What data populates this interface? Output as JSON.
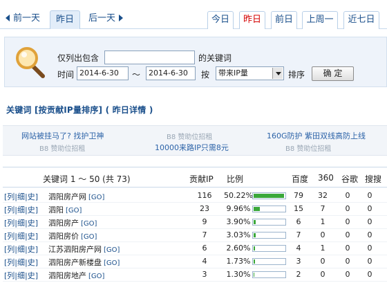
{
  "day_nav": {
    "prev_label": "前一天",
    "current_label": "昨日",
    "next_label": "后一天"
  },
  "tabs": [
    "今日",
    "昨日",
    "前日",
    "上周一",
    "近七日"
  ],
  "active_tab": "昨日",
  "filter": {
    "only_contains_label": "仅列出包含",
    "keyword_suffix": "的关键词",
    "keyword_value": "",
    "time_label": "时间",
    "date_from": "2014-6-30",
    "range_sep": "～",
    "date_to": "2014-6-30",
    "by_label": "按",
    "sort_select_value": "带来IP量",
    "order_label": "排序",
    "confirm_label": "确 定"
  },
  "heading": "关键词 [按贡献IP量排序] ( 昨日详情 )",
  "ads": {
    "row1": [
      "网站被挂马了? 找护卫神",
      "B8 赞助位招租",
      "160G防护 紫田双线高防上线"
    ],
    "row2": [
      "B8 赞助位招租",
      "10000来路IP只需8元",
      "B8 赞助位招租"
    ]
  },
  "table": {
    "headers": {
      "keyword": "关键词 1 ～ 50 (共 73)",
      "ip": "贡献IP",
      "ratio": "比例",
      "baidu": "百度",
      "s360": "360",
      "google": "谷歌",
      "sogou": "搜搜"
    },
    "link_labels": [
      "列",
      "细",
      "史"
    ],
    "go_label": "[GO]",
    "rows": [
      {
        "keyword": "泗阳房产网",
        "ip": "116",
        "ratio": "50.22%",
        "ratio_value": 50.22,
        "baidu": "79",
        "s360": "32",
        "google": "0",
        "sogou": "0"
      },
      {
        "keyword": "泗阳",
        "ip": "23",
        "ratio": "9.96%",
        "ratio_value": 9.96,
        "baidu": "15",
        "s360": "7",
        "google": "0",
        "sogou": "0"
      },
      {
        "keyword": "泗阳房产",
        "ip": "9",
        "ratio": "3.90%",
        "ratio_value": 3.9,
        "baidu": "6",
        "s360": "1",
        "google": "0",
        "sogou": "0"
      },
      {
        "keyword": "泗阳房价",
        "ip": "7",
        "ratio": "3.03%",
        "ratio_value": 3.03,
        "baidu": "7",
        "s360": "0",
        "google": "0",
        "sogou": "0"
      },
      {
        "keyword": "江苏泗阳房产网",
        "ip": "6",
        "ratio": "2.60%",
        "ratio_value": 2.6,
        "baidu": "4",
        "s360": "1",
        "google": "0",
        "sogou": "0"
      },
      {
        "keyword": "泗阳房产新楼盘",
        "ip": "4",
        "ratio": "1.73%",
        "ratio_value": 1.73,
        "baidu": "3",
        "s360": "0",
        "google": "0",
        "sogou": "0"
      },
      {
        "keyword": "泗阳房地产",
        "ip": "3",
        "ratio": "1.30%",
        "ratio_value": 1.3,
        "baidu": "2",
        "s360": "0",
        "google": "0",
        "sogou": "0"
      }
    ]
  },
  "colors": {
    "link": "#1a4f8b",
    "active_tab_text": "#d40000",
    "bar_fill": "#3aa83a",
    "panel_bg": "#eef3fa"
  }
}
